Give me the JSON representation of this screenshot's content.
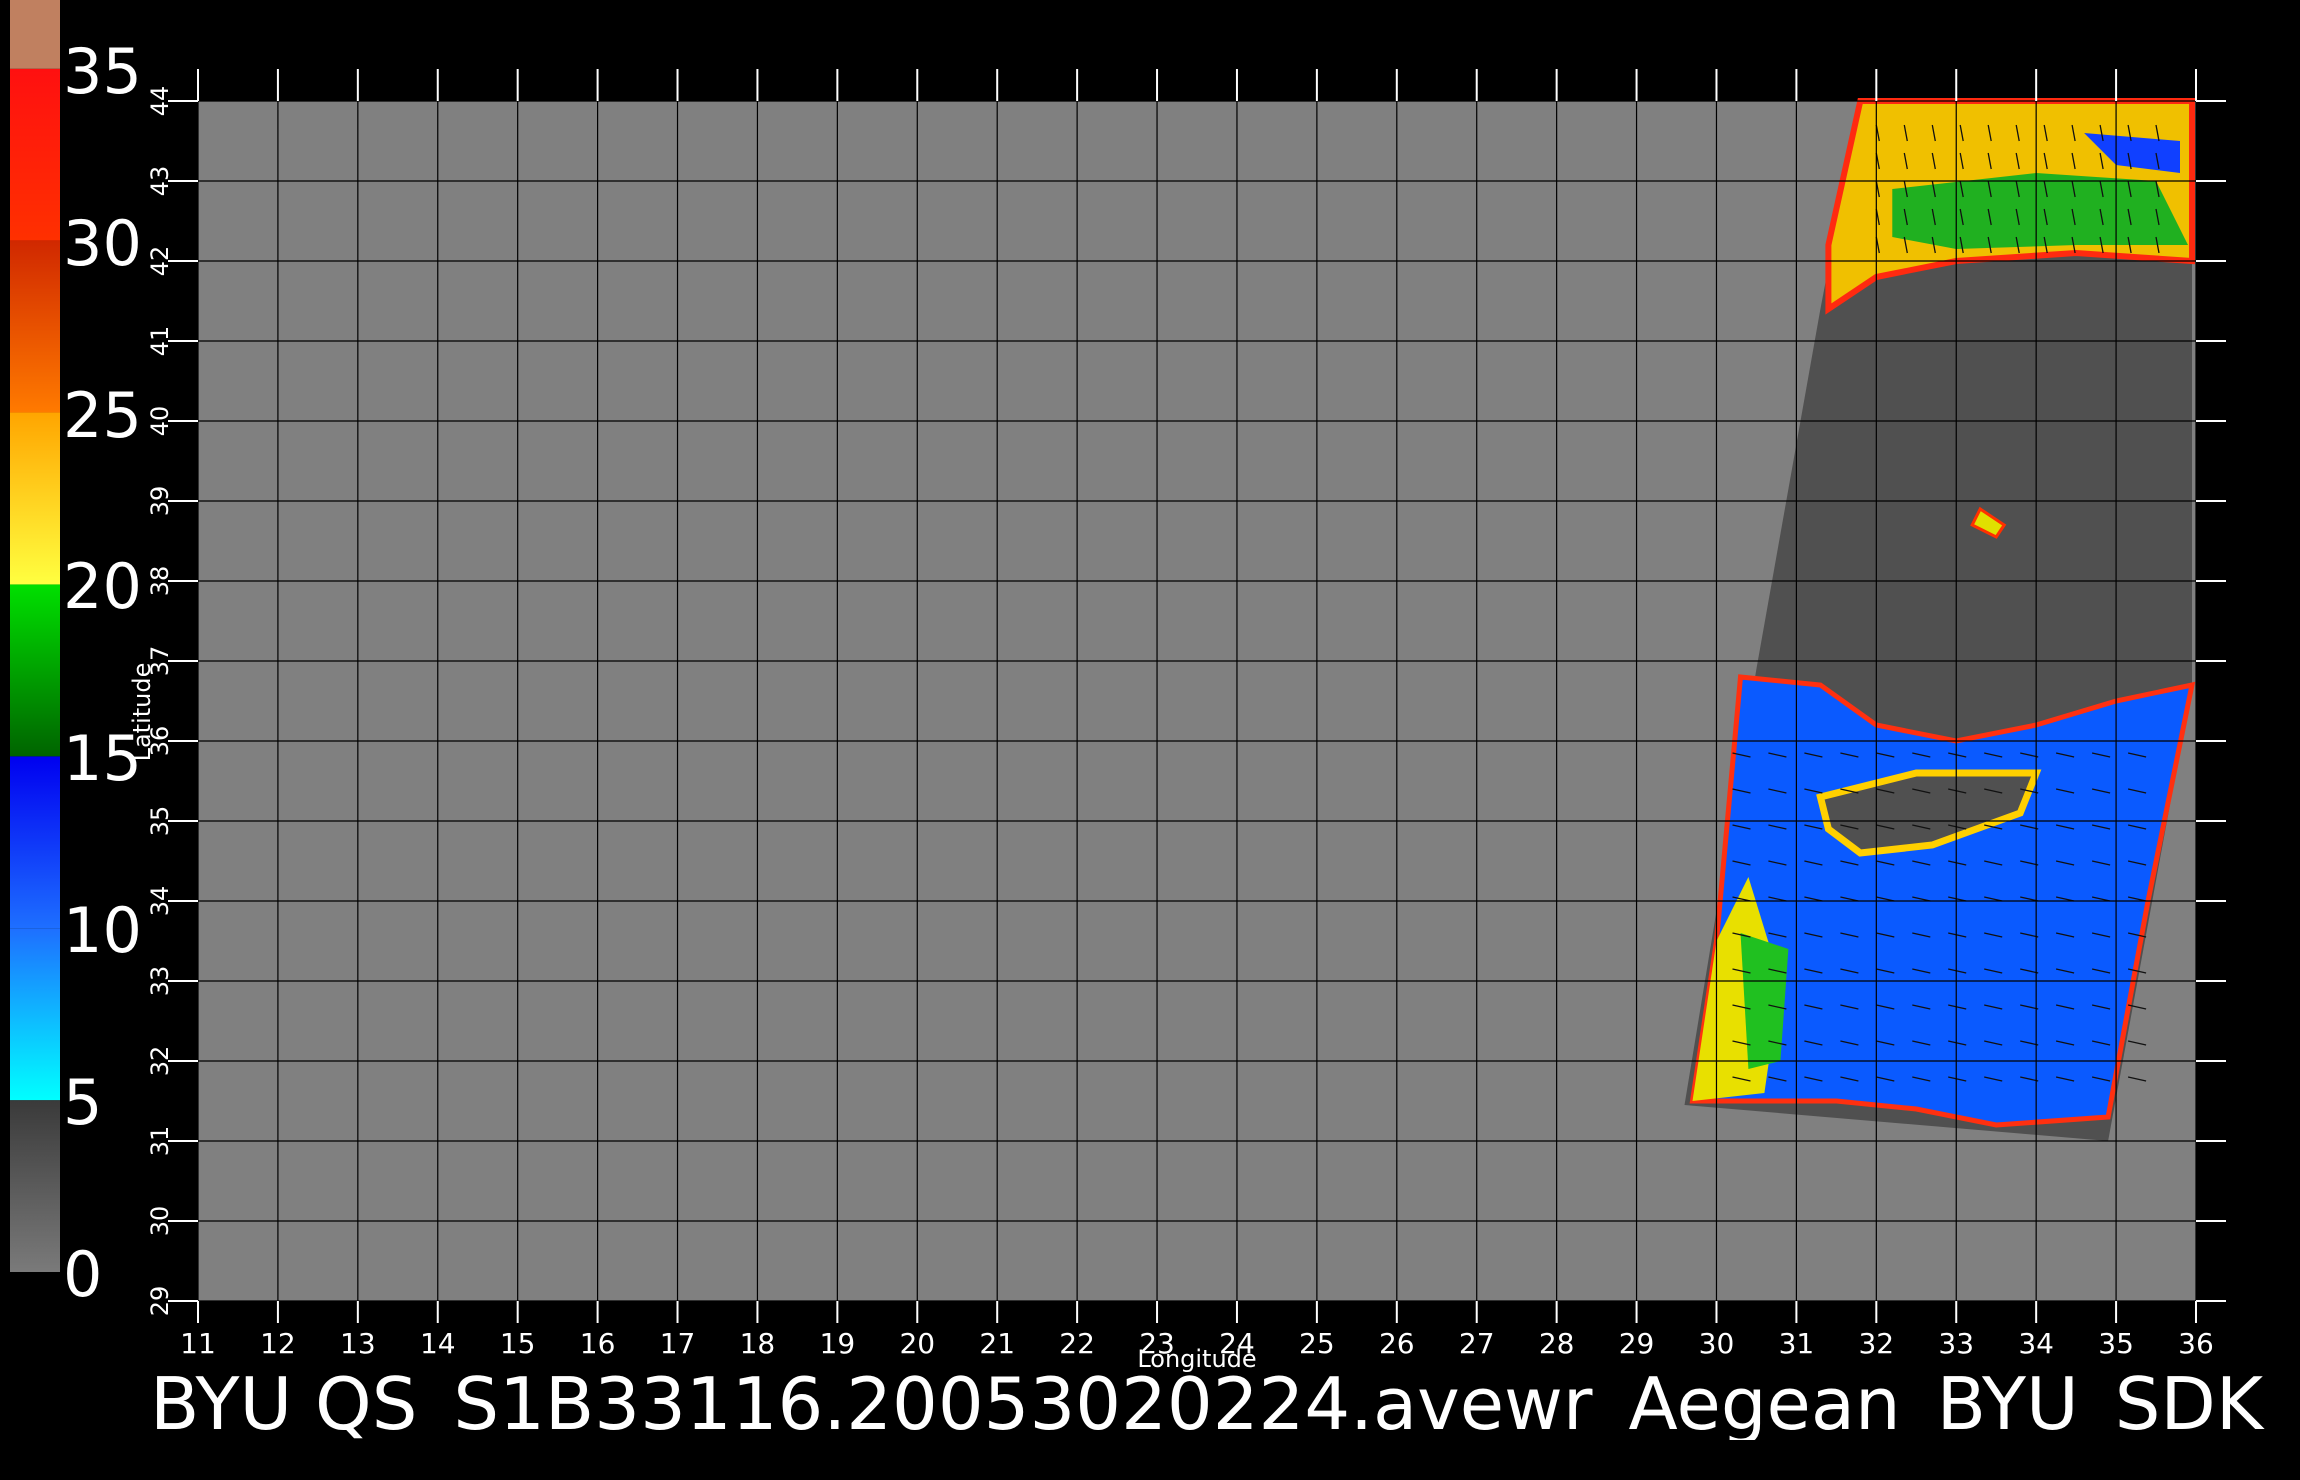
{
  "colorbar": {
    "labels": [
      "0",
      "5",
      "10",
      "15",
      "20",
      "25",
      "30",
      "35"
    ],
    "bands": [
      {
        "from": 0,
        "to": 5,
        "c1": "#7a7a7a",
        "c2": "#3a3a3a"
      },
      {
        "from": 5,
        "to": 10,
        "c1": "#00ffff",
        "c2": "#1e6fff"
      },
      {
        "from": 10,
        "to": 15,
        "c1": "#1e6fff",
        "c2": "#0000f0"
      },
      {
        "from": 15,
        "to": 20,
        "c1": "#006400",
        "c2": "#00e000"
      },
      {
        "from": 20,
        "to": 25,
        "c1": "#ffff40",
        "c2": "#ffa500"
      },
      {
        "from": 25,
        "to": 30,
        "c1": "#ff7a00",
        "c2": "#d02800"
      },
      {
        "from": 30,
        "to": 35,
        "c1": "#ff3000",
        "c2": "#ff1010"
      },
      {
        "from": 35,
        "to": 37,
        "c1": "#c08060",
        "c2": "#c08060"
      }
    ]
  },
  "map": {
    "xaxis": {
      "label": "Longitude",
      "min": 11,
      "max": 36,
      "ticks": [
        "11",
        "12",
        "13",
        "14",
        "15",
        "16",
        "17",
        "18",
        "19",
        "20",
        "21",
        "22",
        "23",
        "24",
        "25",
        "26",
        "27",
        "28",
        "29",
        "30",
        "31",
        "32",
        "33",
        "34",
        "35",
        "36"
      ]
    },
    "yaxis": {
      "label": "Latitude",
      "min": 29,
      "max": 44,
      "ticks": [
        "29",
        "30",
        "31",
        "32",
        "33",
        "34",
        "35",
        "36",
        "37",
        "38",
        "39",
        "40",
        "41",
        "42",
        "43",
        "44"
      ]
    },
    "background_color": "#808080",
    "land_color": "#505050",
    "grid_color": "#000000"
  },
  "footer": {
    "title": "BYU  QS_S1B33116.20053020224.avewr_Aegean_BYU_SDK"
  }
}
